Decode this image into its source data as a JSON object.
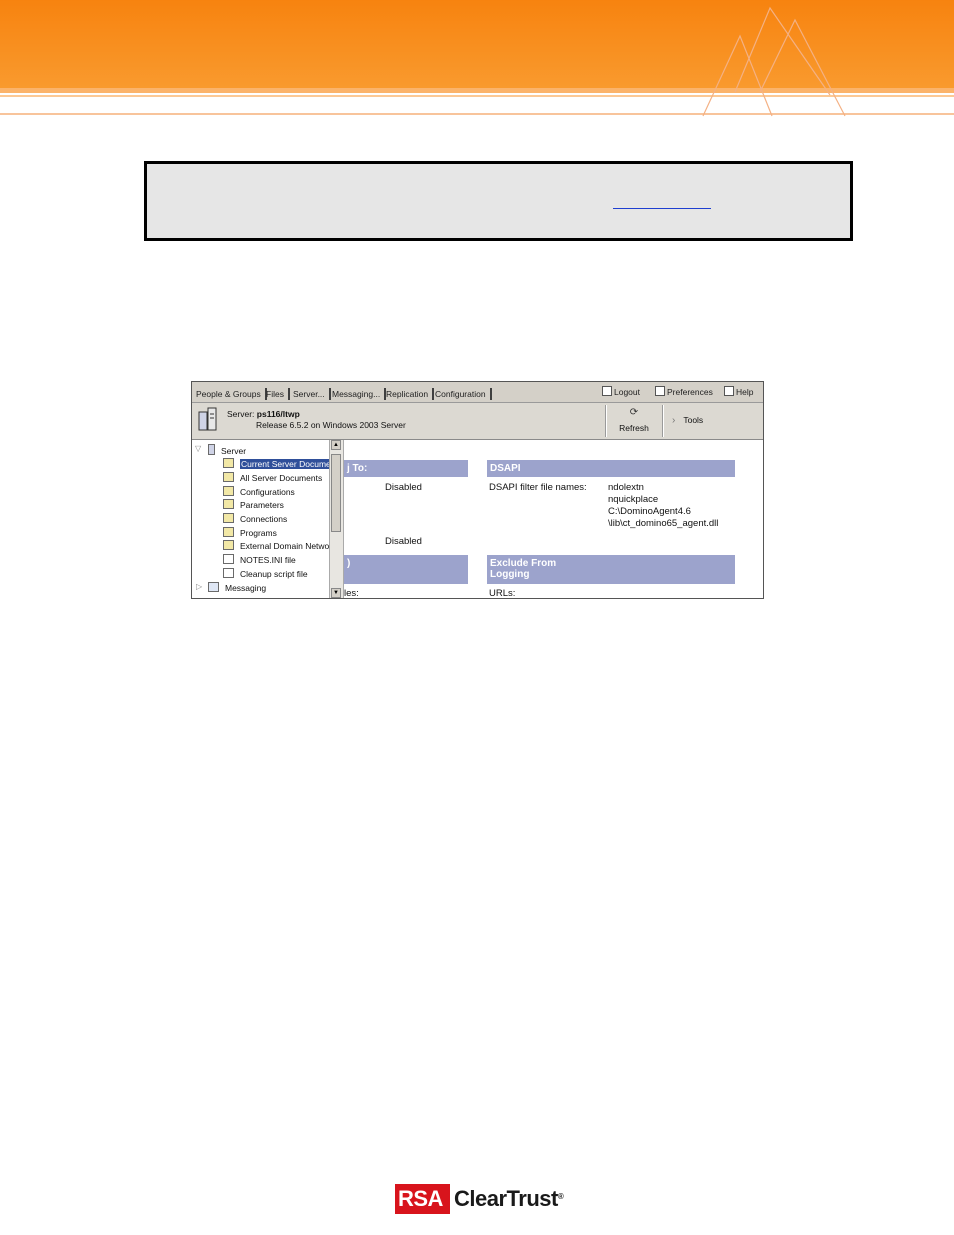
{
  "colors": {
    "banner_orange": "#f7830f",
    "section_header": "#9ca3cc",
    "selected_row": "#2f4f9a",
    "logo_red": "#d8141c"
  },
  "admin": {
    "tabs": [
      "People & Groups",
      "Files",
      "Server...",
      "Messaging...",
      "Replication",
      "Configuration"
    ],
    "top_actions": {
      "logout": "Logout",
      "preferences": "Preferences",
      "help": "Help"
    },
    "server_prefix": "Server:",
    "server_name": "ps116/ltwp",
    "release": "Release 6.5.2 on Windows 2003 Server",
    "refresh_label": "Refresh",
    "tools_label": "Tools",
    "tree": {
      "root": "Server",
      "items": [
        "Current Server Documen",
        "All Server Documents",
        "Configurations",
        "Parameters",
        "Connections",
        "Programs",
        "External Domain Network",
        "NOTES.INI file",
        "Cleanup script file"
      ],
      "next_root": "Messaging"
    },
    "pane": {
      "left_header": "j To:",
      "left_value_1": "Disabled",
      "left_value_2": "Disabled",
      "left_header_2": ")",
      "left_bottom_text": "les:",
      "dsapi_header": "DSAPI",
      "dsapi_label": "DSAPI filter file names:",
      "dsapi_values": [
        "ndolextn",
        "nquickplace",
        "C:\\DominoAgent4.6",
        "\\lib\\ct_domino65_agent.dll"
      ],
      "exclude_header_line1": "Exclude From",
      "exclude_header_line2": "Logging",
      "urls_label": "URLs:"
    }
  },
  "footer": {
    "logo_rsa": "RSA",
    "logo_product": "ClearTrust",
    "logo_reg": "®"
  }
}
